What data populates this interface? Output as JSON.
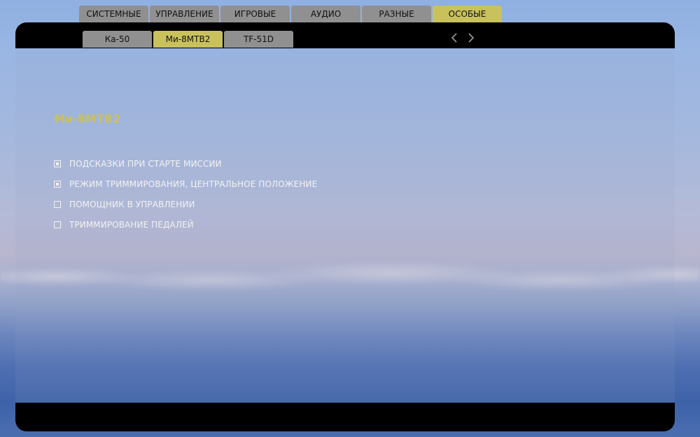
{
  "top_tabs": [
    {
      "label": "СИСТЕМНЫЕ",
      "active": false
    },
    {
      "label": "УПРАВЛЕНИЕ",
      "active": false
    },
    {
      "label": "ИГРОВЫЕ",
      "active": false
    },
    {
      "label": "АУДИО",
      "active": false
    },
    {
      "label": "РАЗНЫЕ",
      "active": false
    },
    {
      "label": "ОСОБЫЕ",
      "active": true
    }
  ],
  "sub_tabs": [
    {
      "label": "Ка-50",
      "active": false
    },
    {
      "label": "Ми-8МТВ2",
      "active": true
    },
    {
      "label": "TF-51D",
      "active": false
    }
  ],
  "nav": {
    "prev_icon": "chevron-left-icon",
    "next_icon": "chevron-right-icon"
  },
  "section": {
    "title": "Ми-8МТВ2",
    "options": [
      {
        "label": "ПОДСКАЗКИ ПРИ СТАРТЕ МИССИИ",
        "checked": true
      },
      {
        "label": "РЕЖИМ ТРИММИРОВАНИЯ, ЦЕНТРАЛЬНОЕ ПОЛОЖЕНИЕ",
        "checked": true
      },
      {
        "label": "ПОМОЩНИК В УПРАВЛЕНИИ",
        "checked": false
      },
      {
        "label": "ТРИММИРОВАНИЕ ПЕДАЛЕЙ",
        "checked": false
      }
    ]
  },
  "colors": {
    "accent": "#c9c15c",
    "tab_inactive": "#909090",
    "bar": "#000000",
    "text": "#f2f2f2"
  }
}
